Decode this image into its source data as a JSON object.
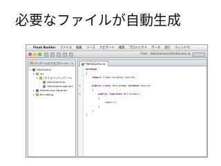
{
  "slide": {
    "title": "必要なファイルが自動生成"
  },
  "menubar": {
    "apple": "",
    "app_name": "Flash Builder",
    "items": [
      "ファイル",
      "編集",
      "ソース",
      "ナビゲート",
      "検索",
      "プロジェクト",
      "データ",
      "実行",
      "ウィンドウ"
    ]
  },
  "window": {
    "title": "Flash - HelloGame/src/HelloGame.as"
  },
  "explorer": {
    "tab_label": "パッケージエクスプローラー",
    "tab_close": "×",
    "tree": [
      {
        "label": "HelloGame",
        "indent": 0,
        "toggle": "▾",
        "icon": "project"
      },
      {
        "label": "src",
        "indent": 1,
        "toggle": "▾",
        "icon": "folder"
      },
      {
        "label": "(デフォルトパッケージ)",
        "indent": 2,
        "toggle": "▾",
        "icon": "package"
      },
      {
        "label": "HelloGame.as",
        "indent": 3,
        "toggle": "",
        "icon": "as-file"
      },
      {
        "label": "HelloGame-app.xml",
        "indent": 3,
        "toggle": "",
        "icon": "xml-file"
      },
      {
        "label": "Referenced Libraries",
        "indent": 1,
        "toggle": "▸",
        "icon": "library"
      },
      {
        "label": "bin-debug",
        "indent": 1,
        "toggle": "▸",
        "icon": "folder"
      }
    ]
  },
  "editor": {
    "tab_label": "*HelloGame.as",
    "lines": [
      [
        {
          "t": "package",
          "c": "kw"
        }
      ],
      [
        {
          "t": "{"
        }
      ],
      [
        {
          "t": "    "
        },
        {
          "t": "import",
          "c": "kw"
        },
        {
          "t": " flash.display.Sprite;"
        }
      ],
      [
        {
          "t": ""
        }
      ],
      [
        {
          "t": "    "
        },
        {
          "t": "public",
          "c": "kw"
        },
        {
          "t": " "
        },
        {
          "t": "class",
          "c": "kw"
        },
        {
          "t": " HelloGame "
        },
        {
          "t": "extends",
          "c": "kw"
        },
        {
          "t": " Sprite"
        }
      ],
      [
        {
          "t": "    {"
        }
      ],
      [
        {
          "t": "        "
        },
        {
          "t": "public",
          "c": "kw"
        },
        {
          "t": " "
        },
        {
          "t": "function",
          "c": "kw"
        },
        {
          "t": " HelloGame()",
          "c": "fn"
        }
      ],
      [
        {
          "t": "        {"
        }
      ],
      [
        {
          "t": "            super();"
        }
      ],
      [
        {
          "t": "        }"
        }
      ],
      [
        {
          "t": "    }"
        }
      ],
      [
        {
          "t": "}"
        }
      ]
    ],
    "markers": {
      "4": "⊖",
      "6": "⊖"
    }
  },
  "colors": {
    "project": "#4a78c2",
    "folder": "#d9a53a",
    "package": "#c79a3a",
    "as-file": "#6d8fc7",
    "xml-file": "#8a8a8a",
    "library": "#8d6bb5"
  }
}
